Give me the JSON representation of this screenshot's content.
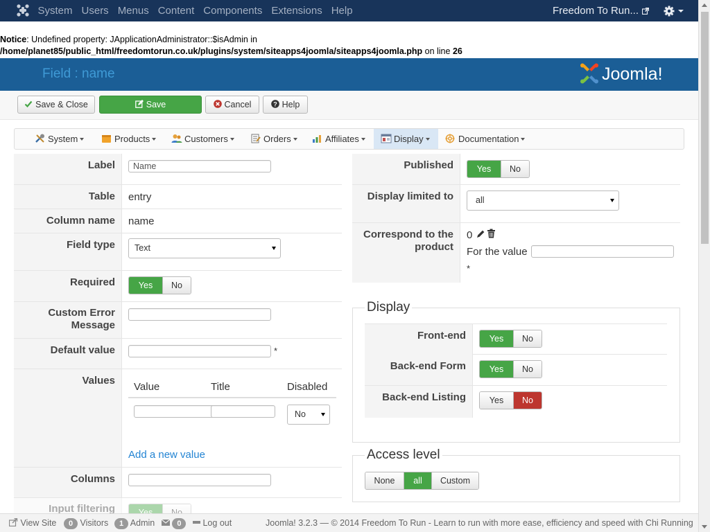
{
  "topbar": {
    "menu": [
      "System",
      "Users",
      "Menus",
      "Content",
      "Components",
      "Extensions",
      "Help"
    ],
    "site_name": "Freedom To Run...",
    "icons": {
      "logo": "joomla-icon",
      "site": "external-link-icon",
      "gear": "gear-icon"
    }
  },
  "notice": {
    "label": "Notice",
    "text": ": Undefined property: JApplicationAdministrator::$isAdmin in",
    "path": "/home/planet85/public_html/freedomtorun.co.uk/plugins/system/siteapps4joomla/siteapps4joomla.php",
    "online": " on line ",
    "line": "26"
  },
  "header": {
    "title": "Field : name",
    "brand": "Joomla!"
  },
  "toolbar": {
    "save_close": "Save & Close",
    "save": "Save",
    "cancel": "Cancel",
    "help": "Help"
  },
  "submenu": [
    "System",
    "Products",
    "Customers",
    "Orders",
    "Affiliates",
    "Display",
    "Documentation"
  ],
  "left": {
    "label": {
      "label": "Label",
      "value": "Name"
    },
    "table": {
      "label": "Table",
      "value": "entry"
    },
    "column": {
      "label": "Column name",
      "value": "name"
    },
    "fieldtype": {
      "label": "Field type",
      "value": "Text"
    },
    "required": {
      "label": "Required",
      "yes": "Yes",
      "no": "No"
    },
    "custom_error": {
      "label_1": "Custom Error",
      "label_2": "Message",
      "value": ""
    },
    "default_value": {
      "label": "Default value",
      "value": "",
      "star": "*"
    },
    "values": {
      "label": "Values",
      "headers": [
        "Value",
        "Title",
        "Disabled"
      ],
      "disabled_value": "No",
      "add_link": "Add a new value"
    },
    "columns": {
      "label": "Columns",
      "value": ""
    },
    "input_filtering": {
      "label": "Input filtering",
      "yes": "Yes",
      "no": "No"
    }
  },
  "right": {
    "published": {
      "label": "Published",
      "yes": "Yes",
      "no": "No"
    },
    "display_limited": {
      "label": "Display limited to",
      "value": "all"
    },
    "correspond": {
      "label_1": "Correspond to the",
      "label_2": "product",
      "count": "0",
      "for_value": "For the value",
      "star": "*"
    },
    "display_legend": "Display",
    "frontend": {
      "label": "Front-end",
      "yes": "Yes",
      "no": "No"
    },
    "backend_form": {
      "label": "Back-end Form",
      "yes": "Yes",
      "no": "No"
    },
    "backend_listing": {
      "label": "Back-end Listing",
      "yes": "Yes",
      "no": "No"
    },
    "access_legend": "Access level",
    "access": {
      "none": "None",
      "all": "all",
      "custom": "Custom"
    }
  },
  "status": {
    "view_site": "View Site",
    "visitors_count": "0",
    "visitors": "Visitors",
    "admin_count": "1",
    "admin": "Admin",
    "msg_count": "0",
    "logout": "Log out",
    "footer": "Joomla! 3.2.3  —  © 2014 Freedom To Run - Learn to run with more ease, efficiency and speed with Chi Running"
  },
  "colors": {
    "navbar": "#18345a",
    "header": "#1b5e96",
    "green": "#46a546",
    "red": "#bd362f",
    "link": "#2384d3"
  }
}
